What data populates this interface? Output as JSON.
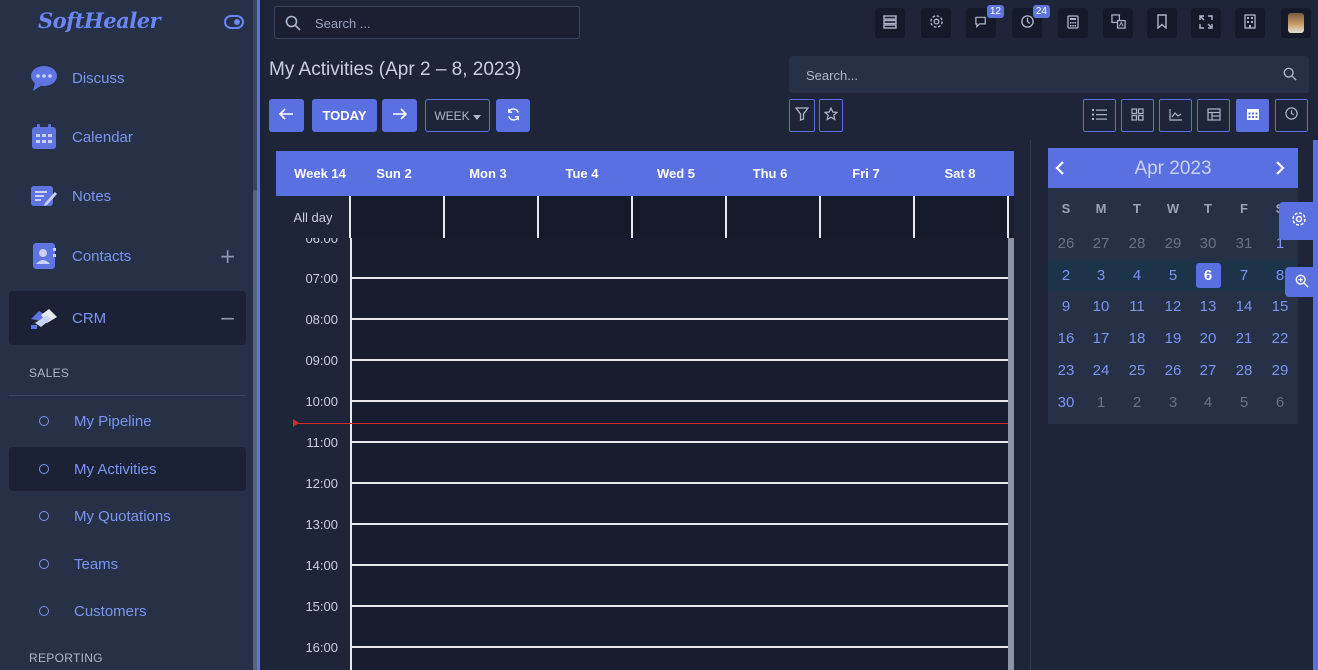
{
  "app": {
    "logo_text": "SoftHealer"
  },
  "sidebar": {
    "items": [
      {
        "label": "Discuss",
        "icon": "discuss-icon"
      },
      {
        "label": "Calendar",
        "icon": "calendar-icon"
      },
      {
        "label": "Notes",
        "icon": "notes-icon"
      },
      {
        "label": "Contacts",
        "icon": "contacts-icon",
        "action": "+"
      },
      {
        "label": "CRM",
        "icon": "crm-icon",
        "action": "−",
        "active": true
      }
    ],
    "sections": [
      {
        "label": "SALES"
      },
      {
        "label": "REPORTING"
      }
    ],
    "sub_items": [
      {
        "label": "My Pipeline"
      },
      {
        "label": "My Activities",
        "active": true
      },
      {
        "label": "My Quotations"
      },
      {
        "label": "Teams"
      },
      {
        "label": "Customers"
      }
    ]
  },
  "topbar": {
    "search_placeholder": "Search ...",
    "icons": [
      "task-list-icon",
      "settings-gear-icon",
      "chat-icon",
      "clock-icon",
      "calculator-icon",
      "translate-icon",
      "bookmark-icon",
      "fullscreen-icon",
      "company-building-icon"
    ],
    "badges": {
      "chat": "12",
      "activity": "24"
    },
    "accent_color": "#5a6fe0"
  },
  "control_panel": {
    "title": "My Activities (Apr 2 – 8, 2023)",
    "search_placeholder": "Search...",
    "today_label": "TODAY",
    "scale_label": "WEEK",
    "views": [
      "list-view-icon",
      "kanban-view-icon",
      "graph-view-icon",
      "pivot-view-icon",
      "calendar-view-icon",
      "activity-view-icon"
    ],
    "active_view": "calendar-view-icon"
  },
  "week_view": {
    "week_label": "Week 14",
    "days": [
      "Sun 2",
      "Mon 3",
      "Tue 4",
      "Wed 5",
      "Thu 6",
      "Fri 7",
      "Sat 8"
    ],
    "all_day_label": "All day",
    "hours": [
      "06:00",
      "07:00",
      "08:00",
      "09:00",
      "10:00",
      "11:00",
      "12:00",
      "13:00",
      "14:00",
      "15:00",
      "16:00"
    ],
    "now_indicator_color": "#d22b2b"
  },
  "mini_calendar": {
    "title": "Apr 2023",
    "weekdays": [
      "S",
      "M",
      "T",
      "W",
      "T",
      "F",
      "S"
    ],
    "weeks": [
      [
        "26",
        "27",
        "28",
        "29",
        "30",
        "31",
        "1"
      ],
      [
        "2",
        "3",
        "4",
        "5",
        "6",
        "7",
        "8"
      ],
      [
        "9",
        "10",
        "11",
        "12",
        "13",
        "14",
        "15"
      ],
      [
        "16",
        "17",
        "18",
        "19",
        "20",
        "21",
        "22"
      ],
      [
        "23",
        "24",
        "25",
        "26",
        "27",
        "28",
        "29"
      ],
      [
        "30",
        "1",
        "2",
        "3",
        "4",
        "5",
        "6"
      ]
    ],
    "today": "6",
    "current_week_index": 1
  }
}
